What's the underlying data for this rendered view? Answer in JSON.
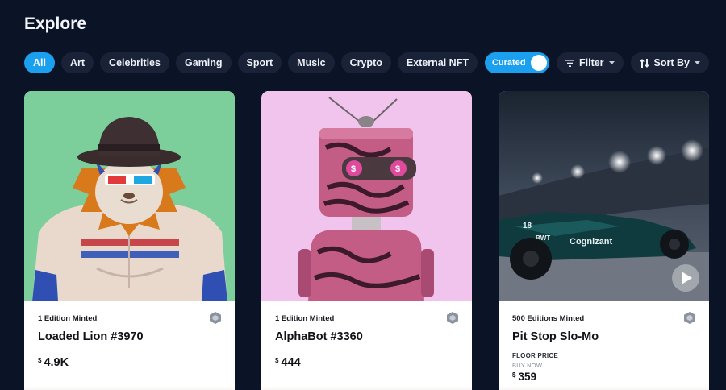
{
  "page": {
    "title": "Explore"
  },
  "filters": [
    "All",
    "Art",
    "Celebrities",
    "Gaming",
    "Sport",
    "Music",
    "Crypto",
    "External NFT"
  ],
  "controls": {
    "curated_label": "Curated",
    "filter_label": "Filter",
    "sort_label": "Sort By"
  },
  "cards": [
    {
      "minted": "1 Edition Minted",
      "name": "Loaded Lion #3970",
      "currency": "$",
      "price": "4.9K"
    },
    {
      "minted": "1 Edition Minted",
      "name": "AlphaBot #3360",
      "currency": "$",
      "price": "444"
    },
    {
      "minted": "500 Editions Minted",
      "name": "Pit Stop Slo-Mo",
      "floor_label": "FLOOR PRICE",
      "buy_now_label": "BUY NOW",
      "currency": "$",
      "price": "359"
    }
  ],
  "colors": {
    "background": "#0b1326",
    "chip": "#1a2238",
    "accent": "#1aa0ee",
    "card": "#ffffff"
  }
}
